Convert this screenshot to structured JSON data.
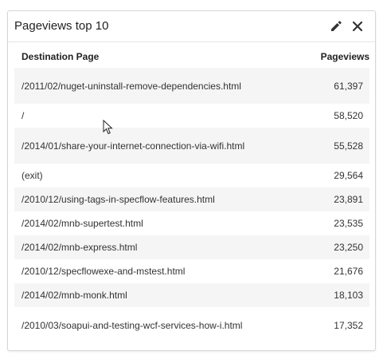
{
  "widget": {
    "title": "Pageviews top 10",
    "icons": {
      "edit": "pencil-icon",
      "close": "close-icon"
    }
  },
  "table": {
    "columns": [
      "Destination Page",
      "Pageviews"
    ],
    "rows": [
      {
        "page": "/2011/02/nuget-uninstall-remove-dependencies.html",
        "views": "61,397"
      },
      {
        "page": "/",
        "views": "58,520"
      },
      {
        "page": "/2014/01/share-your-internet-connection-via-wifi.html",
        "views": "55,528"
      },
      {
        "page": "(exit)",
        "views": "29,564"
      },
      {
        "page": "/2010/12/using-tags-in-specflow-features.html",
        "views": "23,891"
      },
      {
        "page": "/2014/02/mnb-supertest.html",
        "views": "23,535"
      },
      {
        "page": "/2014/02/mnb-express.html",
        "views": "23,250"
      },
      {
        "page": "/2010/12/specflowexe-and-mstest.html",
        "views": "21,676"
      },
      {
        "page": "/2014/02/mnb-monk.html",
        "views": "18,103"
      },
      {
        "page": "/2010/03/soapui-and-testing-wcf-services-how-i.html",
        "views": "17,352"
      }
    ]
  },
  "colors": {
    "stripe": "#f5f5f5",
    "border": "#d6d6d6",
    "text": "#333333"
  }
}
